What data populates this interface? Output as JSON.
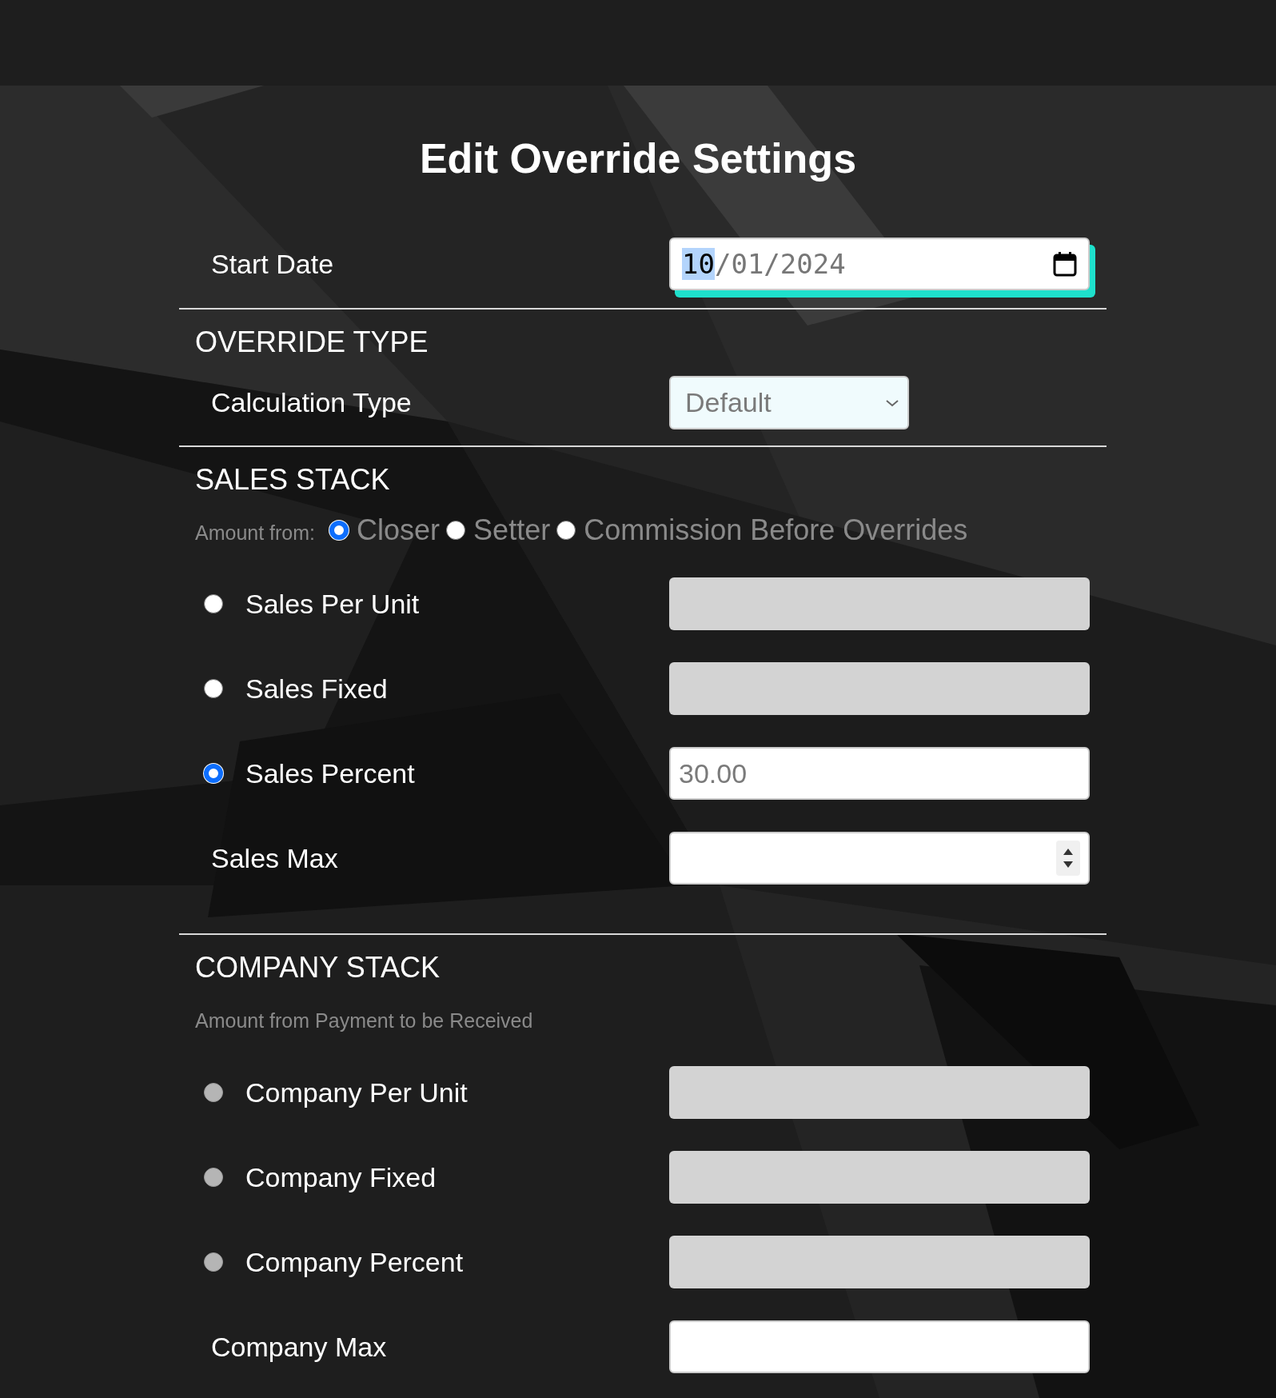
{
  "title": "Edit Override Settings",
  "start_date": {
    "label": "Start Date",
    "focused": true,
    "segments": [
      {
        "text": "10",
        "selected": true
      },
      {
        "text": "/01/2024",
        "selected": false
      }
    ]
  },
  "override_type": {
    "heading": "OVERRIDE TYPE",
    "calculation": {
      "label": "Calculation Type",
      "value": "Default"
    }
  },
  "sales_stack": {
    "heading": "SALES STACK",
    "amount_from": {
      "label": "Amount from:",
      "options": [
        {
          "label": "Closer",
          "selected": true
        },
        {
          "label": "Setter",
          "selected": false
        },
        {
          "label": "Commission Before Overrides",
          "selected": false
        }
      ]
    },
    "rows": [
      {
        "kind": "radio",
        "label": "Sales Per Unit",
        "selected": false,
        "disabled": false,
        "field": {
          "disabled": true
        }
      },
      {
        "kind": "radio",
        "label": "Sales Fixed",
        "selected": false,
        "disabled": false,
        "field": {
          "disabled": true
        }
      },
      {
        "kind": "radio",
        "label": "Sales Percent",
        "selected": true,
        "disabled": false,
        "field": {
          "disabled": false,
          "placeholder": "30.00"
        }
      },
      {
        "kind": "plain",
        "label": "Sales Max",
        "field": {
          "disabled": false,
          "spinner": true
        }
      }
    ]
  },
  "company_stack": {
    "heading": "COMPANY STACK",
    "caption": "Amount from Payment to be Received",
    "rows": [
      {
        "kind": "radio",
        "label": "Company Per Unit",
        "selected": false,
        "disabled": true,
        "field": {
          "disabled": true
        }
      },
      {
        "kind": "radio",
        "label": "Company Fixed",
        "selected": false,
        "disabled": true,
        "field": {
          "disabled": true
        }
      },
      {
        "kind": "radio",
        "label": "Company Percent",
        "selected": false,
        "disabled": true,
        "field": {
          "disabled": true
        }
      },
      {
        "kind": "plain",
        "label": "Company Max",
        "field": {
          "disabled": false,
          "spinner": false
        }
      }
    ]
  }
}
